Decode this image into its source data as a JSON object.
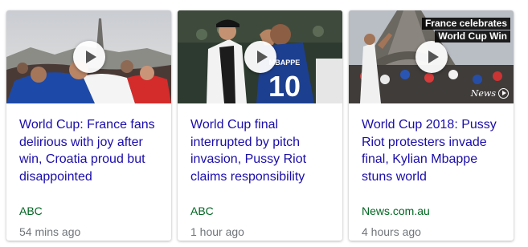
{
  "cards": [
    {
      "headline": "World Cup: France fans delirious with joy after win, Croatia proud but disappointed",
      "source": "ABC",
      "time": "54 mins ago",
      "thumbnail_icon": "play-icon"
    },
    {
      "headline": "World Cup final interrupted by pitch invasion, Pussy Riot claims responsibility",
      "source": "ABC",
      "time": "1 hour ago",
      "thumbnail_icon": "play-icon",
      "jersey_name": "MBAPPE",
      "jersey_number": "10"
    },
    {
      "headline": "World Cup 2018: Pussy Riot protesters invade final, Kylian Mbappe stuns world",
      "source": "News.com.au",
      "time": "4 hours ago",
      "thumbnail_icon": "play-icon",
      "overlay_line1": "France celebrates",
      "overlay_line2": "World Cup Win",
      "watermark": "News"
    }
  ],
  "colors": {
    "headline": "#1a0dab",
    "source": "#006621",
    "time": "#70757a"
  }
}
